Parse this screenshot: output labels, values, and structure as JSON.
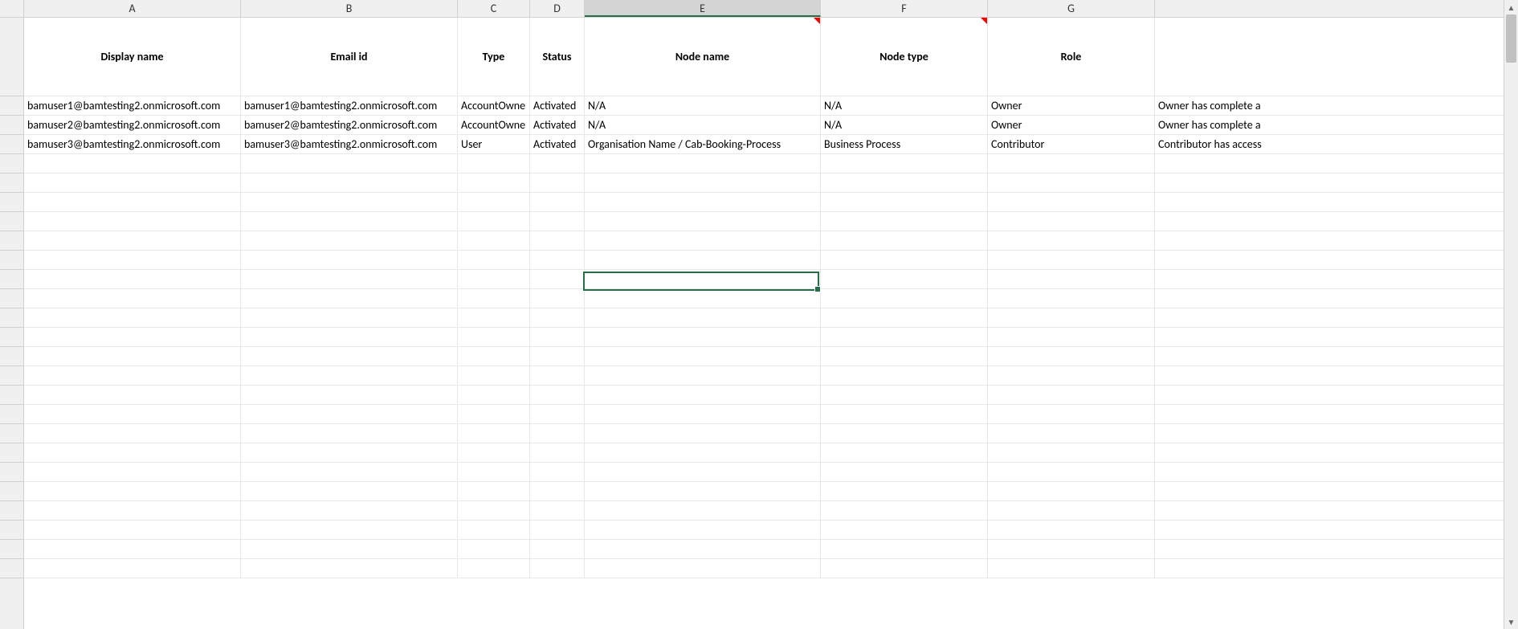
{
  "columns": [
    "A",
    "B",
    "C",
    "D",
    "E",
    "F",
    "G"
  ],
  "selectedColumn": "E",
  "headers": {
    "A": "Display name",
    "B": "Email id",
    "C": "Type",
    "D": "Status",
    "E": "Node name",
    "F": "Node type",
    "G": "Role"
  },
  "rows": [
    {
      "A": "bamuser1@bamtesting2.onmicrosoft.com",
      "B": "bamuser1@bamtesting2.onmicrosoft.com",
      "C": "AccountOwne",
      "D": "Activated",
      "E": "N/A",
      "F": "N/A",
      "G": "Owner",
      "H": "Owner has complete a"
    },
    {
      "A": "bamuser2@bamtesting2.onmicrosoft.com",
      "B": "bamuser2@bamtesting2.onmicrosoft.com",
      "C": "AccountOwne",
      "D": "Activated",
      "E": "N/A",
      "F": "N/A",
      "G": "Owner",
      "H": "Owner has complete a"
    },
    {
      "A": "bamuser3@bamtesting2.onmicrosoft.com",
      "B": "bamuser3@bamtesting2.onmicrosoft.com",
      "C": "User",
      "D": "Activated",
      "E": "Organisation Name / Cab-Booking-Process",
      "F": "Business Process",
      "G": "Contributor",
      "H": "Contributor has access"
    }
  ],
  "emptyRowCount": 22,
  "commentCells": [
    "E1",
    "F1"
  ],
  "selectedCell": "E14"
}
